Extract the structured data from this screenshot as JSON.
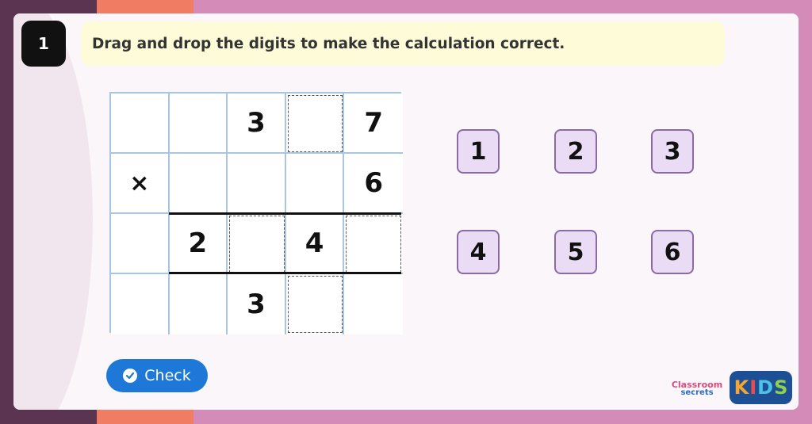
{
  "question_number": "1",
  "instruction": "Drag and drop the digits to make the calculation correct.",
  "grid": {
    "rows": [
      [
        {
          "text": "",
          "drop": false
        },
        {
          "text": "",
          "drop": false
        },
        {
          "text": "3",
          "drop": false
        },
        {
          "text": "",
          "drop": true
        },
        {
          "text": "7",
          "drop": false
        }
      ],
      [
        {
          "text": "×",
          "drop": false
        },
        {
          "text": "",
          "drop": false
        },
        {
          "text": "",
          "drop": false
        },
        {
          "text": "",
          "drop": false
        },
        {
          "text": "6",
          "drop": false
        }
      ],
      [
        {
          "text": "",
          "drop": false
        },
        {
          "text": "2",
          "drop": false
        },
        {
          "text": "",
          "drop": true
        },
        {
          "text": "4",
          "drop": false
        },
        {
          "text": "",
          "drop": true
        }
      ],
      [
        {
          "text": "",
          "drop": false
        },
        {
          "text": "",
          "drop": false
        },
        {
          "text": "3",
          "drop": false
        },
        {
          "text": "",
          "drop": true
        },
        {
          "text": "",
          "drop": false
        }
      ]
    ]
  },
  "tiles": [
    "1",
    "2",
    "3",
    "4",
    "5",
    "6"
  ],
  "check_button": {
    "label": "Check",
    "color": "#1e78d7"
  },
  "logo": {
    "classroom": "Classroom",
    "secrets": "secrets",
    "kids": [
      "K",
      "I",
      "D",
      "S"
    ],
    "kids_colors": [
      "#f4a534",
      "#e84d4d",
      "#4cc3e6",
      "#8fd14f"
    ]
  },
  "colors": {
    "background": "#d58bb7",
    "card": "#fbf6f9",
    "instruction_bg": "#fdfbd8",
    "grid_border": "#a8c6df",
    "tile_bg": "#eadcf4",
    "tile_border": "#8b6aa8"
  }
}
